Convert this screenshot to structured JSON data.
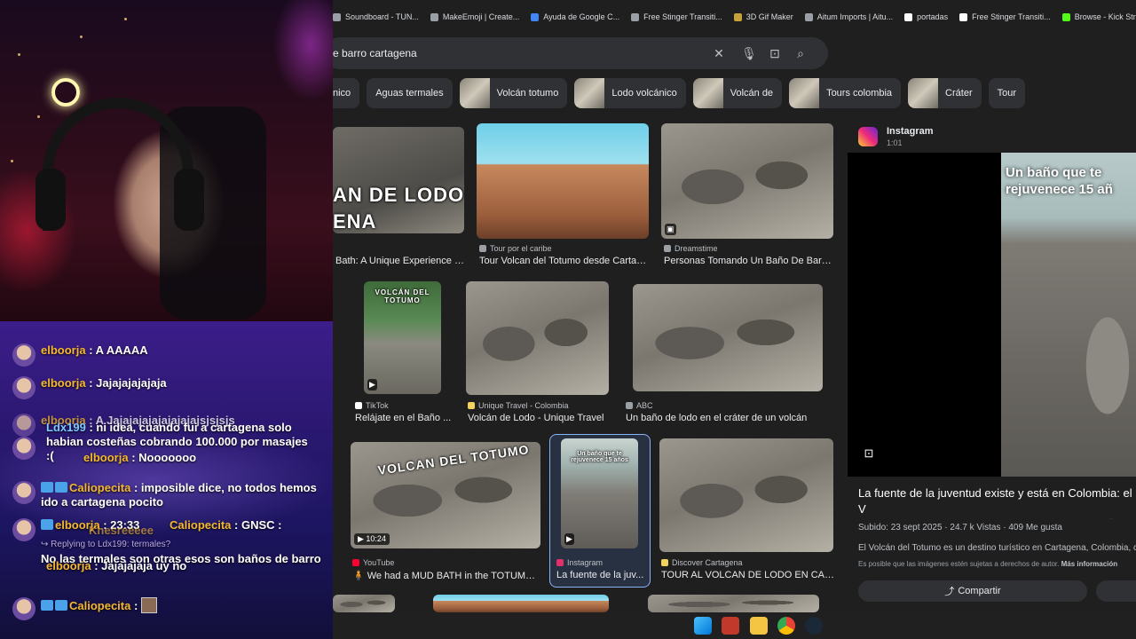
{
  "bookmarks": [
    {
      "label": "Soundboard - TUN..."
    },
    {
      "label": "MakeEmoji | Create..."
    },
    {
      "label": "Ayuda de Google C..."
    },
    {
      "label": "Free Stinger Transiti..."
    },
    {
      "label": "3D Gif Maker"
    },
    {
      "label": "Aitum Imports | Aitu..."
    },
    {
      "label": "portadas"
    },
    {
      "label": "Free Stinger Transiti..."
    },
    {
      "label": "Browse - Kick Strea..."
    }
  ],
  "search": {
    "query": "e barro cartagena"
  },
  "chips": [
    {
      "label": "nico"
    },
    {
      "label": "Aguas termales"
    },
    {
      "label": "Volcán totumo"
    },
    {
      "label": "Lodo volcánico"
    },
    {
      "label": "Volcán de"
    },
    {
      "label": "Tours colombia"
    },
    {
      "label": "Cráter"
    },
    {
      "label": "Tour"
    }
  ],
  "results": [
    {
      "source": "",
      "title": "Bath: A Unique Experience a...",
      "overlay": "AN DE LODO\nENA"
    },
    {
      "source": "Tour por el caribe",
      "title": "Tour Volcan del Totumo desde Cartage..."
    },
    {
      "source": "Dreamstime",
      "title": "Personas Tomando Un Baño De Barro..."
    },
    {
      "source": "TikTok",
      "title": "Relájate en el Baño ...",
      "overlay": "VOLCÁN DEL\nTOTUMO"
    },
    {
      "source": "Unique Travel - Colombia",
      "title": "Volcán de Lodo - Unique Travel"
    },
    {
      "source": "ABC",
      "title": "Un baño de lodo en el cráter de un volcán"
    },
    {
      "source": "YouTube",
      "title": "🧍 We had a MUD BATH in the TOTUMO ...",
      "overlay": "VOLCAN DEL TOTUMO",
      "duration": "10:24"
    },
    {
      "source": "Instagram",
      "title": "La fuente de la juv...",
      "overlay": "Un baño que te\nrejuvenece 15 años"
    },
    {
      "source": "Discover Cartagena",
      "title": "TOUR AL VOLCAN DE LODO EN CAR..."
    }
  ],
  "preview": {
    "source": "Instagram",
    "duration": "1:01",
    "overlay": "Un baño que te\nrejuvenece 15 añ",
    "title": "La fuente de la juventud existe y está en Colombia: el V\nLos detalles del tour de encuentran en el video. 🧍 co",
    "meta": "Subido: 23 sept 2025   ·   24.7 k Vistas   ·   409 Me gusta",
    "description": "El Volcán del Totumo es un destino turístico en Cartagena, Colombia, co",
    "rights": "Es posible que las imágenes estén sujetas a derechos de autor.",
    "rights_link": "Más información",
    "share_label": "Compartir"
  },
  "chat": {
    "messages": [
      {
        "user": "elboorja",
        "text": ": A AAAAA"
      },
      {
        "user": "elboorja",
        "text": ": Jajajajajajaja"
      },
      {
        "user": "elboorja",
        "text": ": A Jajajajajajajajajajsjsjsjs"
      },
      {
        "user": "Ldx199",
        "text": ": ni idea, cuando fui a cartagena solo habian costeñas cobrando 100.000 por masajes :("
      },
      {
        "user": "elboorja",
        "text": ": Nooooooo"
      },
      {
        "user": "Caliopecita",
        "text": ": imposible dice, no todos hemos ido a cartagena pocito"
      },
      {
        "user": "elboorja",
        "text": ": 23:33"
      },
      {
        "user": "Caliopecita",
        "text": ": GNSC :"
      },
      {
        "reply": "↪ Replying to Ldx199: termales?",
        "text": "No las termales son otras esos son baños de barro"
      },
      {
        "user": "elboorja",
        "text": ": Jajajajaja uy no"
      },
      {
        "user": "Khesreeeee",
        "text": ""
      },
      {
        "user": "Caliopecita",
        "text": ":"
      }
    ]
  },
  "taskbar": [
    "windows-icon",
    "edge-icon",
    "file-explorer-icon",
    "chrome-icon",
    "steam-icon"
  ]
}
